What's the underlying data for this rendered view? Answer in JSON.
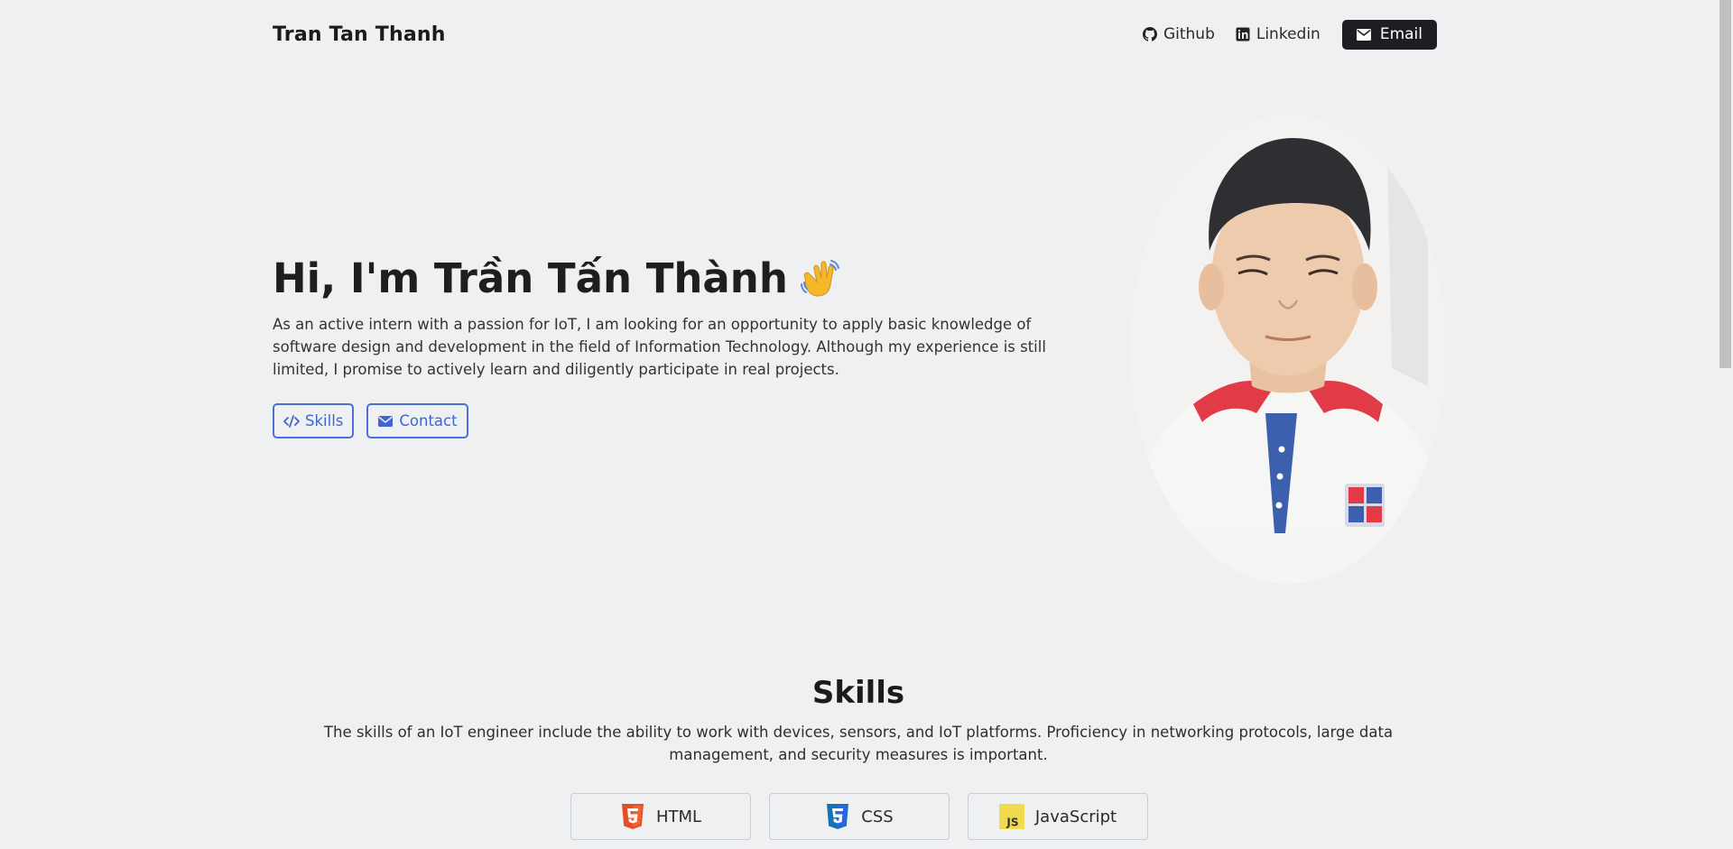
{
  "header": {
    "brand": "Tran Tan Thanh",
    "nav": [
      {
        "label": "Github",
        "icon": "github-icon"
      },
      {
        "label": "Linkedin",
        "icon": "linkedin-icon"
      }
    ],
    "email_label": "Email"
  },
  "hero": {
    "title": "Hi, I'm Trần Tấn Thành",
    "description": "As an active intern with a passion for IoT, I am looking for an opportunity to apply basic knowledge of software design and development in the field of Information Technology. Although my experience is still limited, I promise to actively learn and diligently participate in real projects.",
    "buttons": [
      {
        "label": "Skills",
        "icon": "code-icon"
      },
      {
        "label": "Contact",
        "icon": "envelope-icon"
      }
    ]
  },
  "skills": {
    "title": "Skills",
    "description": "The skills of an IoT engineer include the ability to work with devices, sensors, and IoT platforms. Proficiency in networking protocols, large data management, and security measures is important.",
    "items": [
      {
        "label": "HTML",
        "icon": "html5-icon",
        "color": "#e44d26"
      },
      {
        "label": "CSS",
        "icon": "css3-icon",
        "color": "#2965f1"
      },
      {
        "label": "JavaScript",
        "icon": "javascript-icon",
        "color": "#f0db4f"
      }
    ]
  }
}
